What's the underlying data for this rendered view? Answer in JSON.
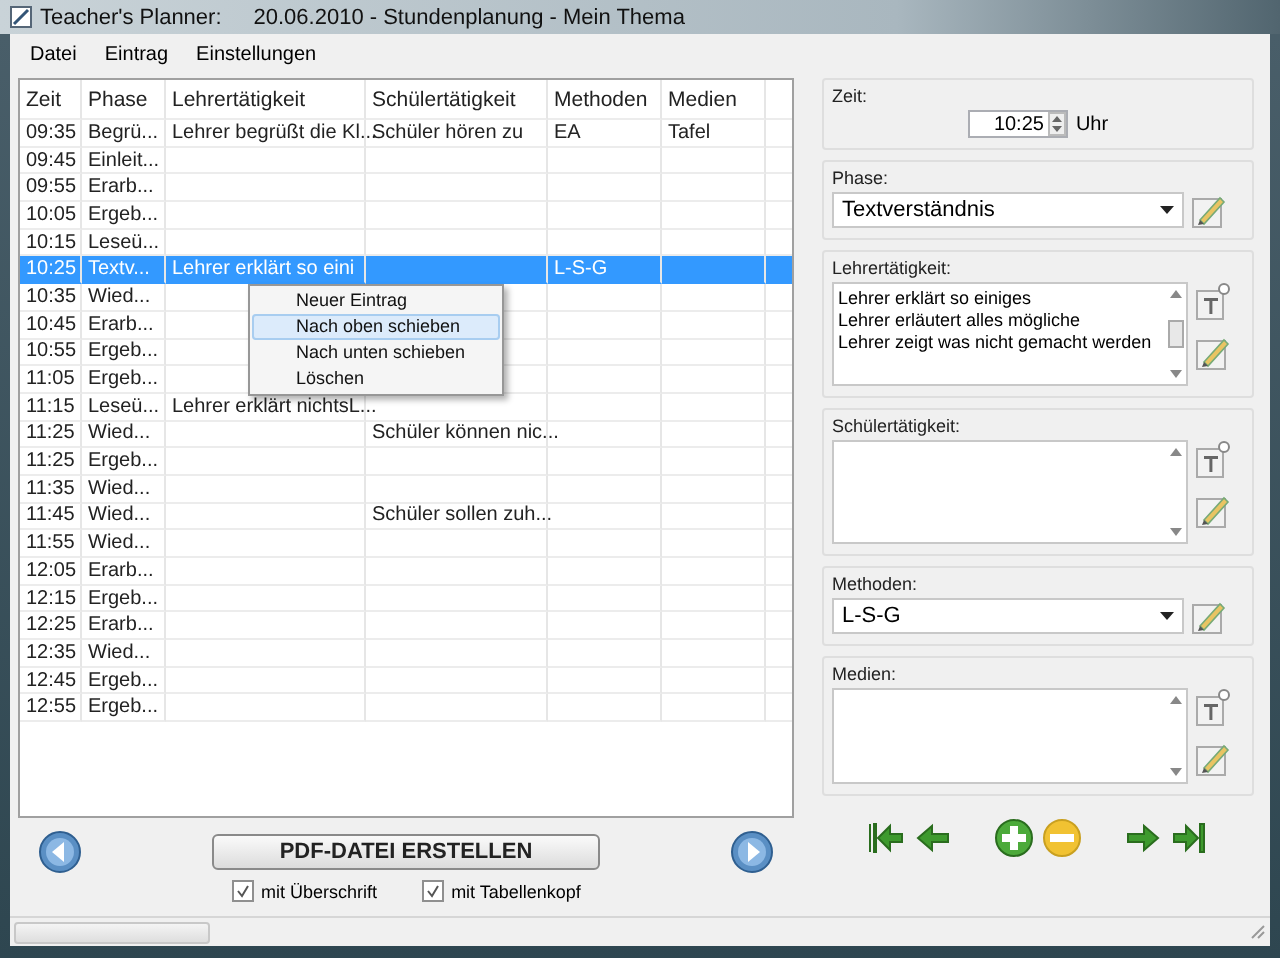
{
  "window": {
    "title": "Teacher's Planner:",
    "document": "20.06.2010 - Stundenplanung - Mein Thema"
  },
  "menu": [
    "Datei",
    "Eintrag",
    "Einstellungen"
  ],
  "table": {
    "columns": [
      "Zeit",
      "Phase",
      "Lehrertätigkeit",
      "Schülertätigkeit",
      "Methoden",
      "Medien"
    ],
    "rows": [
      {
        "selected": false,
        "cells": [
          "09:35",
          "Begrü...",
          "Lehrer begrüßt die Kl...",
          "Schüler hören zu",
          "EA",
          "Tafel"
        ]
      },
      {
        "selected": false,
        "cells": [
          "09:45",
          "Einleit...",
          "",
          "",
          "",
          ""
        ]
      },
      {
        "selected": false,
        "cells": [
          "09:55",
          "Erarb...",
          "",
          "",
          "",
          ""
        ]
      },
      {
        "selected": false,
        "cells": [
          "10:05",
          "Ergeb...",
          "",
          "",
          "",
          ""
        ]
      },
      {
        "selected": false,
        "cells": [
          "10:15",
          "Leseü...",
          "",
          "",
          "",
          ""
        ]
      },
      {
        "selected": true,
        "cells": [
          "10:25",
          "Textv...",
          "Lehrer erklärt so eini",
          "",
          "L-S-G",
          ""
        ]
      },
      {
        "selected": false,
        "cells": [
          "10:35",
          "Wied...",
          "",
          "",
          "",
          ""
        ]
      },
      {
        "selected": false,
        "cells": [
          "10:45",
          "Erarb...",
          "",
          "",
          "",
          ""
        ]
      },
      {
        "selected": false,
        "cells": [
          "10:55",
          "Ergeb...",
          "",
          "",
          "",
          ""
        ]
      },
      {
        "selected": false,
        "cells": [
          "11:05",
          "Ergeb...",
          "",
          "",
          "",
          ""
        ]
      },
      {
        "selected": false,
        "cells": [
          "11:15",
          "Leseü...",
          "Lehrer erklärt nichtsL...",
          "",
          "",
          ""
        ]
      },
      {
        "selected": false,
        "cells": [
          "11:25",
          "Wied...",
          "",
          "Schüler können nic...",
          "",
          ""
        ]
      },
      {
        "selected": false,
        "cells": [
          "11:25",
          "Ergeb...",
          "",
          "",
          "",
          ""
        ]
      },
      {
        "selected": false,
        "cells": [
          "11:35",
          "Wied...",
          "",
          "",
          "",
          ""
        ]
      },
      {
        "selected": false,
        "cells": [
          "11:45",
          "Wied...",
          "",
          "Schüler sollen zuh...",
          "",
          ""
        ]
      },
      {
        "selected": false,
        "cells": [
          "11:55",
          "Wied...",
          "",
          "",
          "",
          ""
        ]
      },
      {
        "selected": false,
        "cells": [
          "12:05",
          "Erarb...",
          "",
          "",
          "",
          ""
        ]
      },
      {
        "selected": false,
        "cells": [
          "12:15",
          "Ergeb...",
          "",
          "",
          "",
          ""
        ]
      },
      {
        "selected": false,
        "cells": [
          "12:25",
          "Erarb...",
          "",
          "",
          "",
          ""
        ]
      },
      {
        "selected": false,
        "cells": [
          "12:35",
          "Wied...",
          "",
          "",
          "",
          ""
        ]
      },
      {
        "selected": false,
        "cells": [
          "12:45",
          "Ergeb...",
          "",
          "",
          "",
          ""
        ]
      },
      {
        "selected": false,
        "cells": [
          "12:55",
          "Ergeb...",
          "",
          "",
          "",
          ""
        ]
      }
    ]
  },
  "context_menu": [
    {
      "label": "Neuer Eintrag",
      "selected": false
    },
    {
      "label": "Nach oben schieben",
      "selected": true
    },
    {
      "label": "Nach unten schieben",
      "selected": false
    },
    {
      "label": "Löschen",
      "selected": false
    }
  ],
  "pdf_button": "PDF-DATEI ERSTELLEN",
  "options": [
    {
      "label": "mit Überschrift",
      "checked": true
    },
    {
      "label": "mit Tabellenkopf",
      "checked": true
    }
  ],
  "details": [
    {
      "kind": "time",
      "label": "Zeit:",
      "value": "10:25",
      "unit": "Uhr"
    },
    {
      "kind": "select",
      "label": "Phase:",
      "value": "Textverständnis"
    },
    {
      "kind": "text",
      "label": "Lehrertätigkeit:",
      "lines": [
        "Lehrer erklärt so einiges",
        "Lehrer erläutert alles mögliche",
        "Lehrer zeigt was nicht gemacht werden"
      ]
    },
    {
      "kind": "text",
      "label": "Schülertätigkeit:"
    },
    {
      "kind": "select",
      "label": "Methoden:",
      "value": "L-S-G"
    },
    {
      "kind": "text",
      "label": "Medien:"
    }
  ]
}
